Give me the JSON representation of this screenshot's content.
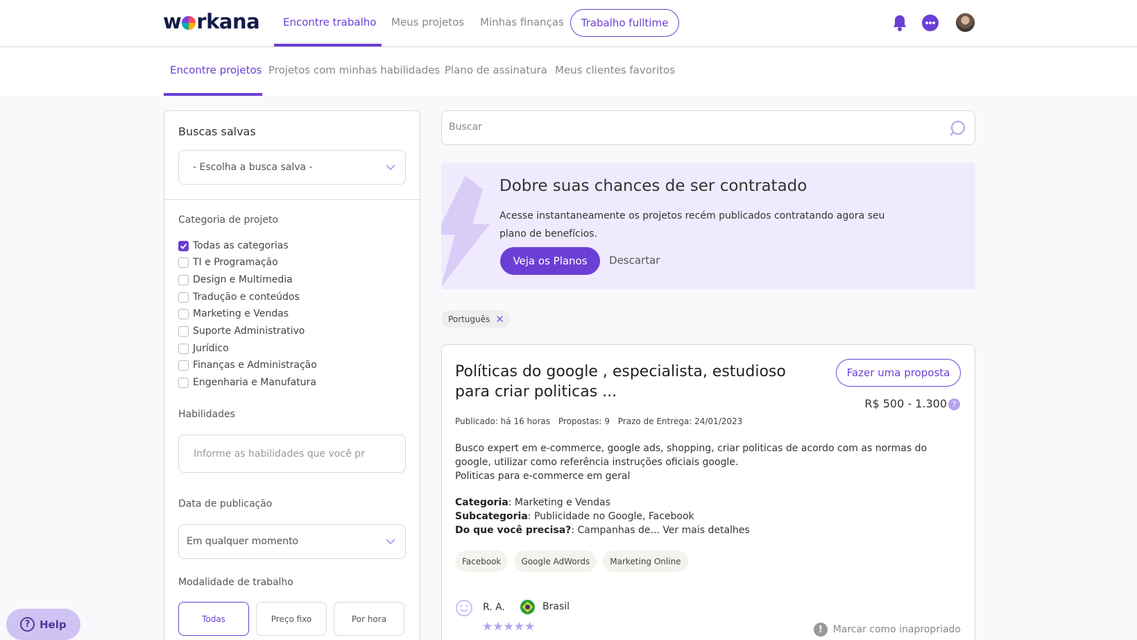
{
  "header": {
    "logo": "workana",
    "nav": [
      "Encontre trabalho",
      "Meus projetos",
      "Minhas finanças"
    ],
    "fulltime_button": "Trabalho fulltime"
  },
  "subnav": [
    "Encontre projetos",
    "Projetos com minhas habilidades",
    "Plano de assinatura",
    "Meus clientes favoritos"
  ],
  "sidebar": {
    "saved_searches_title": "Buscas salvas",
    "saved_search_select": "- Escolha a busca salva -",
    "category_label": "Categoria de projeto",
    "categories": [
      {
        "label": "Todas as categorias",
        "checked": true
      },
      {
        "label": "TI e Programação",
        "checked": false
      },
      {
        "label": "Design e Multimedia",
        "checked": false
      },
      {
        "label": "Tradução e conteúdos",
        "checked": false
      },
      {
        "label": "Marketing e Vendas",
        "checked": false
      },
      {
        "label": "Suporte Administrativo",
        "checked": false
      },
      {
        "label": "Jurídico",
        "checked": false
      },
      {
        "label": "Finanças e Administração",
        "checked": false
      },
      {
        "label": "Engenharia e Manufatura",
        "checked": false
      }
    ],
    "skills_label": "Habilidades",
    "skills_placeholder": "Informe as habilidades que você pr",
    "date_label": "Data de publicação",
    "date_select": "Em qualquer momento",
    "mode_label": "Modalidade de trabalho",
    "modes": [
      "Todas",
      "Preço fixo",
      "Por hora"
    ]
  },
  "help_label": "Help",
  "search": {
    "placeholder": "Buscar"
  },
  "promo": {
    "title": "Dobre suas chances de ser contratado",
    "text": "Acesse instantaneamente os projetos recém publicados contratando agora seu plano de benefícios.",
    "primary_button": "Veja os Planos",
    "secondary_button": "Descartar"
  },
  "filter_tag": "Português",
  "project": {
    "title": "Políticas do google , especialista, estudioso para criar politicas ...",
    "proposal_button": "Fazer uma proposta",
    "price": "R$ 500 - 1.300",
    "published": "Publicado: há 16 horas",
    "proposals": "Propostas: 9",
    "deadline": "Prazo de Entrega: 24/01/2023",
    "description_lines": [
      "Busco expert em e-commerce, google ads, shopping, criar politicas de acordo com as normas do",
      "google, utilizar como referência instruções oficiais google.",
      "Politicas para e-commerce em geral"
    ],
    "category_key": "Categoria",
    "category_value": "Marketing e Vendas",
    "subcategory_key": "Subcategoria",
    "subcategory_value": "Publicidade no Google, Facebook",
    "need_key": "Do que você precisa?",
    "need_value": "Campanhas de... Ver mais detalhes",
    "skills": [
      "Facebook",
      "Google AdWords",
      "Marketing Online"
    ],
    "client_name": "R. A.",
    "client_country": "Brasil",
    "rating_stars": 5,
    "report_label": "Marcar como inapropriado"
  },
  "colors": {
    "accent": "#6b3fd4",
    "promo_bg": "#efeafd",
    "logo": "#131b47"
  }
}
